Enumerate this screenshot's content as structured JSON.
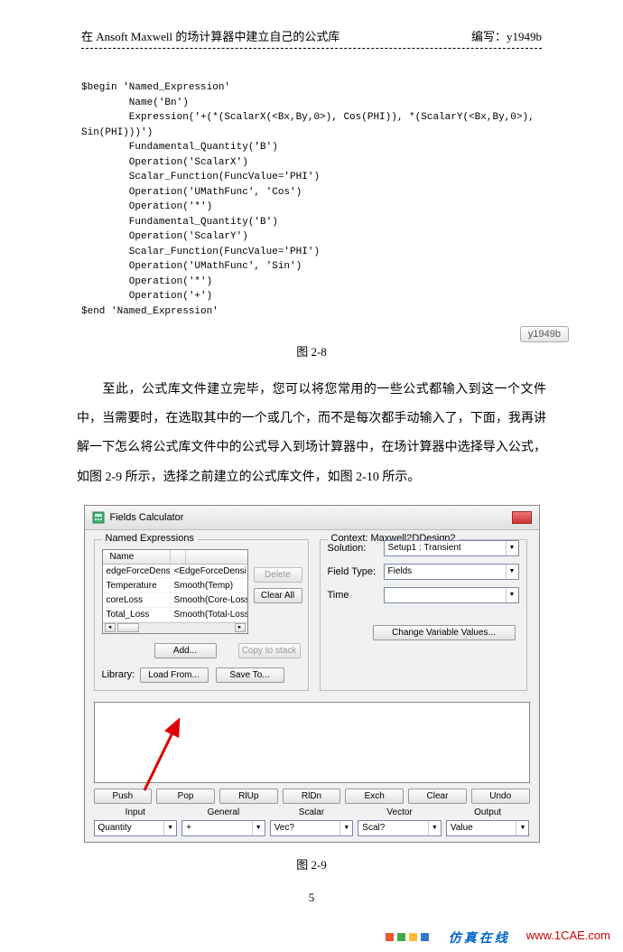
{
  "header": {
    "title": "在 Ansoft Maxwell 的场计算器中建立自己的公式库",
    "author_label": "编写：y1949b"
  },
  "code": "$begin 'Named_Expression'\n        Name('Bn')\n        Expression('+(*(ScalarX(<Bx,By,0>), Cos(PHI)), *(ScalarY(<Bx,By,0>),\nSin(PHI)))')\n        Fundamental_Quantity('B')\n        Operation('ScalarX')\n        Scalar_Function(FuncValue='PHI')\n        Operation('UMathFunc', 'Cos')\n        Operation('*')\n        Fundamental_Quantity('B')\n        Operation('ScalarY')\n        Scalar_Function(FuncValue='PHI')\n        Operation('UMathFunc', 'Sin')\n        Operation('*')\n        Operation('+')\n$end 'Named_Expression'",
  "badge": "y1949b",
  "captions": {
    "fig28": "图 2-8",
    "fig29": "图 2-9"
  },
  "paragraph": "至此，公式库文件建立完毕，您可以将您常用的一些公式都输入到这一个文件中，当需要时，在选取其中的一个或几个，而不是每次都手动输入了，下面，我再讲解一下怎么将公式库文件中的公式导入到场计算器中，在场计算器中选择导入公式，如图 2-9 所示，选择之前建立的公式库文件，如图 2-10 所示。",
  "calc": {
    "window_title": "Fields Calculator",
    "named_expressions": {
      "group": "Named Expressions",
      "header": "Name",
      "rows": [
        {
          "name": "edgeForceDensity",
          "expr": "<EdgeForceDensi"
        },
        {
          "name": "Temperature",
          "expr": "Smooth(Temp)"
        },
        {
          "name": "coreLoss",
          "expr": "Smooth(Core-Loss"
        },
        {
          "name": "Total_Loss",
          "expr": "Smooth(Total-Loss"
        }
      ],
      "delete": "Delete",
      "clear_all": "Clear All",
      "add": "Add...",
      "copy": "Copy to stack",
      "library_label": "Library:",
      "load_from": "Load From...",
      "save_to": "Save To..."
    },
    "context": {
      "label": "Context: Maxwell2DDesign2",
      "solution_label": "Solution:",
      "solution_value": "Setup1 : Transient",
      "field_type_label": "Field Type:",
      "field_type_value": "Fields",
      "time_label": "Time",
      "time_value": "",
      "change_var": "Change Variable Values..."
    },
    "row1": [
      "Push",
      "Pop",
      "RlUp",
      "RlDn",
      "Exch",
      "Clear",
      "Undo"
    ],
    "row2_headers": [
      "Input",
      "General",
      "Scalar",
      "Vector",
      "Output"
    ],
    "row3": [
      "Quantity",
      "+",
      "Vec?",
      "Scal?",
      "Value"
    ]
  },
  "page_number": "5",
  "footer": {
    "zh": "仿真在线",
    "url": "www.1CAE.com"
  }
}
